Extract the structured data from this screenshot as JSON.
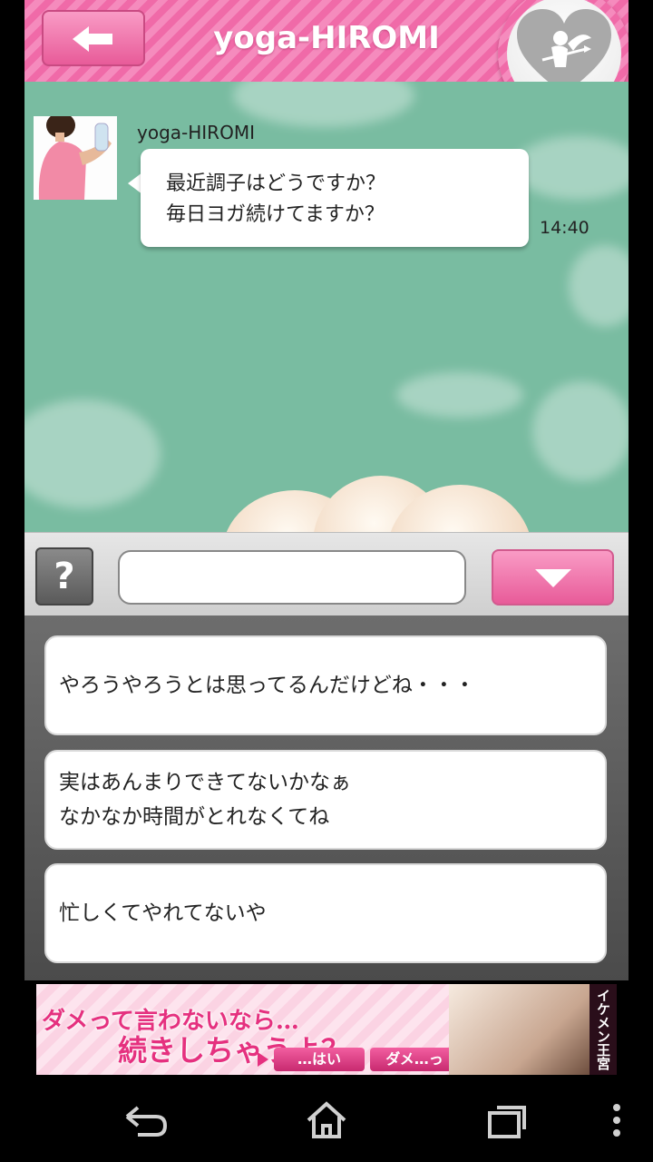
{
  "header": {
    "title": "yoga-HIROMI"
  },
  "chat": {
    "sender": "yoga-HIROMI",
    "message": "最近調子はどうですか？\n毎日ヨガ続けてますか？",
    "time": "14:40"
  },
  "input": {
    "help_label": "?",
    "value": ""
  },
  "choices": [
    "やろうやろうとは思ってるんだけどね・・・",
    "実はあんまりできてないかなぁ\nなかなか時間がとれなくてね",
    "忙しくてやれてないや"
  ],
  "ad": {
    "line1": "ダメって言わないなら…",
    "line2": "続きしちゃうよ？",
    "yes": "…はい",
    "no": "ダメ…っ",
    "brand": "イケメン王宮"
  },
  "colors": {
    "accent": "#f06aa8",
    "chat_bg": "#79bca1"
  },
  "icons": [
    "back-arrow-icon",
    "cupid-heart-icon",
    "help-icon",
    "dropdown-arrow-icon",
    "nav-back-icon",
    "nav-home-icon",
    "nav-recents-icon",
    "nav-menu-icon"
  ]
}
